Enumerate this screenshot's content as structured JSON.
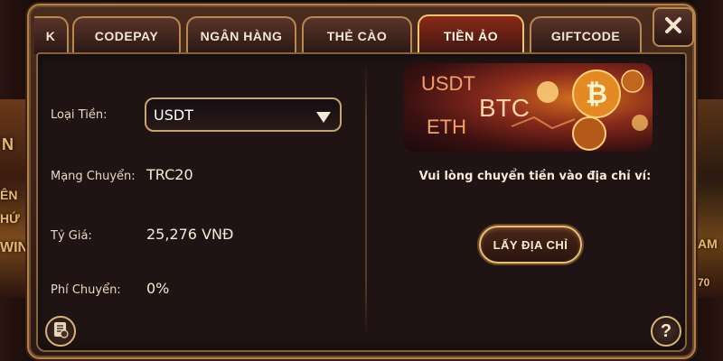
{
  "tabs": [
    {
      "label": "K"
    },
    {
      "label": "CODEPAY"
    },
    {
      "label": "NGÂN HÀNG"
    },
    {
      "label": "THẺ CÀO"
    },
    {
      "label": "TIỀN ẢO",
      "active": true
    },
    {
      "label": "GIFTCODE"
    }
  ],
  "form": {
    "currency_label": "Loại Tiền:",
    "currency_value": "USDT",
    "network_label": "Mạng Chuyển:",
    "network_value": "TRC20",
    "rate_label": "Tỷ Giá:",
    "rate_value": "25,276 VNĐ",
    "fee_label": "Phí Chuyển:",
    "fee_value": "0%"
  },
  "banner": {
    "usdt": "USDT",
    "btc": "BTC",
    "eth": "ETH"
  },
  "instruction": "Vui lòng chuyển tiền vào địa chỉ ví:",
  "get_address_button": "LẤY ĐỊA CHỈ",
  "background": {
    "left_text": "N",
    "left_text_2": "ÊN",
    "left_text_3": "HỨ",
    "left_text_4": "WIN",
    "right_text": "AM",
    "right_text_2": "70"
  },
  "colors": {
    "accent_gold": "#c8a56e",
    "active_tab": "#8a2a18",
    "panel_bg": "#1f1413"
  },
  "icons": {
    "close": "close-icon",
    "dropdown": "triangle-down-icon",
    "history": "history-icon",
    "help": "help-icon"
  }
}
